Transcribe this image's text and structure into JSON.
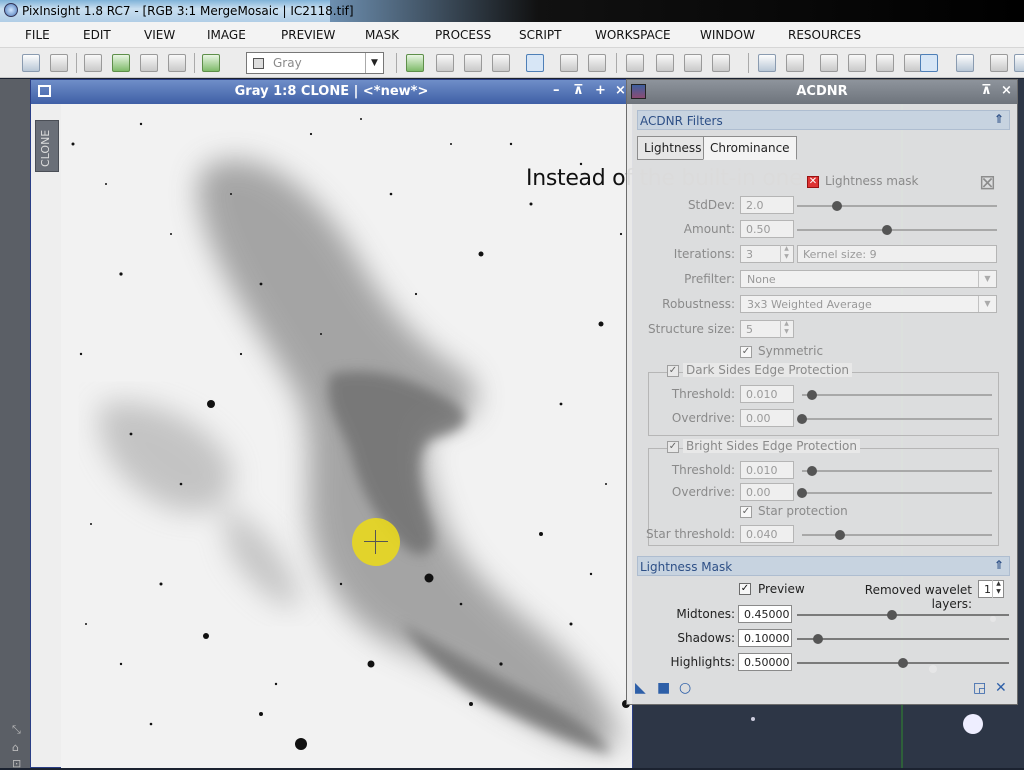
{
  "window": {
    "title": "PixInsight 1.8 RC7 - [RGB 3:1 MergeMosaic | IC2118.tif]"
  },
  "menu": [
    "FILE",
    "EDIT",
    "VIEW",
    "IMAGE",
    "PREVIEW",
    "MASK",
    "PROCESS",
    "SCRIPT",
    "WORKSPACE",
    "WINDOW",
    "RESOURCES"
  ],
  "toolbar": {
    "view_selector": "Gray"
  },
  "image_window": {
    "title": "Gray 1:8 CLONE | <*new*>",
    "side_tab": "CLONE"
  },
  "annotation": "Instead of the built-in one",
  "acdnr": {
    "title": "ACDNR",
    "filters_section": "ACDNR Filters",
    "tabs": [
      "Lightness",
      "Chrominance"
    ],
    "lightness_mask_checkbox": "Lightness mask",
    "stddev_label": "StdDev:",
    "stddev_value": "2.0",
    "amount_label": "Amount:",
    "amount_value": "0.50",
    "iterations_label": "Iterations:",
    "iterations_value": "3",
    "kernel_size": "Kernel size: 9",
    "prefilter_label": "Prefilter:",
    "prefilter_value": "None",
    "robustness_label": "Robustness:",
    "robustness_value": "3x3 Weighted Average",
    "structure_label": "Structure size:",
    "structure_value": "5",
    "symmetric": "Symmetric",
    "dark_group": "Dark Sides Edge Protection",
    "dark_threshold_label": "Threshold:",
    "dark_threshold_value": "0.010",
    "dark_overdrive_label": "Overdrive:",
    "dark_overdrive_value": "0.00",
    "bright_group": "Bright Sides Edge Protection",
    "bright_threshold_label": "Threshold:",
    "bright_threshold_value": "0.010",
    "bright_overdrive_label": "Overdrive:",
    "bright_overdrive_value": "0.00",
    "star_protection": "Star protection",
    "star_threshold_label": "Star threshold:",
    "star_threshold_value": "0.040",
    "mask_section": "Lightness Mask",
    "preview": "Preview",
    "removed_layers_label": "Removed wavelet layers:",
    "removed_layers_value": "1",
    "midtones_label": "Midtones:",
    "midtones_value": "0.45000",
    "shadows_label": "Shadows:",
    "shadows_value": "0.10000",
    "highlights_label": "Highlights:",
    "highlights_value": "0.50000"
  },
  "slider_levels": {
    "stddev": 0.2,
    "amount": 0.45,
    "dark_threshold": 0.05,
    "dark_overdrive": 0.0,
    "bright_threshold": 0.05,
    "bright_overdrive": 0.0,
    "star_threshold": 0.2,
    "midtones": 0.45,
    "shadows": 0.1,
    "highlights": 0.5
  },
  "colors": {
    "window_title_blue": "#4f6fb4",
    "section_header": "#c7d3e0",
    "section_text": "#2d4f86",
    "highlight_circle": "#e9d81e",
    "checkbox_red": "#d33333"
  }
}
